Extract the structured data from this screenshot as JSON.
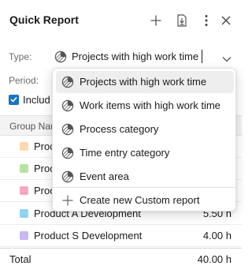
{
  "header": {
    "title": "Quick Report",
    "icons": [
      "plus-icon",
      "export-icon",
      "more-vertical-icon",
      "close-icon"
    ]
  },
  "form": {
    "type_label": "Type:",
    "type_value": "Projects with high work time",
    "period_label": "Period:",
    "include_label": "Includ",
    "include_checked": true
  },
  "dropdown": {
    "items": [
      {
        "label": "Projects with high work time",
        "icon": "pie-chart-icon",
        "selected": true
      },
      {
        "label": "Work items with high work time",
        "icon": "pie-chart-icon",
        "selected": false
      },
      {
        "label": "Process category",
        "icon": "pie-chart-icon",
        "selected": false
      },
      {
        "label": "Time entry category",
        "icon": "pie-chart-icon",
        "selected": false
      },
      {
        "label": "Event area",
        "icon": "pie-chart-icon",
        "selected": false
      }
    ],
    "create_label": "Create new Custom report"
  },
  "table": {
    "group_header": "Group Nar",
    "rows": [
      {
        "name": "Proc",
        "hours": "",
        "color": "#fdd8b5"
      },
      {
        "name": "Proc",
        "hours": "",
        "color": "#b7e4a0"
      },
      {
        "name": "Proc",
        "hours": "",
        "color": "#f7a8c0"
      },
      {
        "name": "Product A Development",
        "hours": "5.50 h",
        "color": "#8fd3f0"
      },
      {
        "name": "Product S Development",
        "hours": "4.00 h",
        "color": "#c7b8ef"
      }
    ],
    "total_label": "Total",
    "total_value": "40.00 h"
  },
  "colors": {
    "accent": "#1a73c8",
    "selected_bg": "#eeeeee",
    "header_bg": "#f3f3f3"
  }
}
